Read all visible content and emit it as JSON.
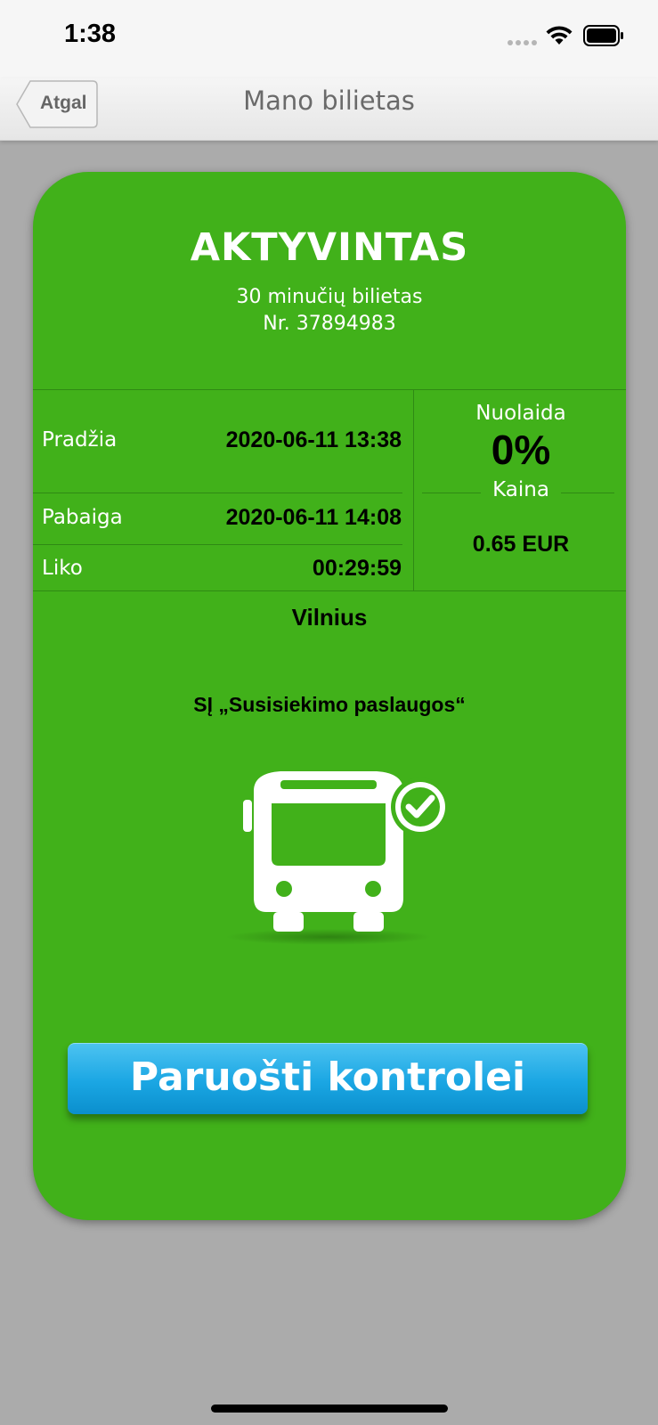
{
  "status_bar": {
    "time": "1:38"
  },
  "nav": {
    "back_label": "Atgal",
    "title": "Mano bilietas"
  },
  "ticket": {
    "status": "AKTYVINTAS",
    "type": "30 minučių bilietas",
    "number": "Nr. 37894983",
    "rows": [
      {
        "label": "Pradžia",
        "value": "2020-06-11 13:38"
      },
      {
        "label": "Pabaiga",
        "value": "2020-06-11 14:08"
      },
      {
        "label": "Liko",
        "value": "00:29:59"
      }
    ],
    "discount_label": "Nuolaida",
    "discount_value": "0%",
    "price_label": "Kaina",
    "price_value": "0.65 EUR",
    "city": "Vilnius",
    "operator": "SĮ „Susisiekimo paslaugos“",
    "control_button_label": "Paruošti kontrolei"
  },
  "colors": {
    "card_green": "#41b11a",
    "button_blue": "#1aa6e3",
    "background_gray": "#ababab"
  },
  "icons": {
    "bus": "bus-active-icon",
    "back": "chevron-left-icon",
    "wifi": "wifi-icon",
    "battery": "battery-icon"
  }
}
